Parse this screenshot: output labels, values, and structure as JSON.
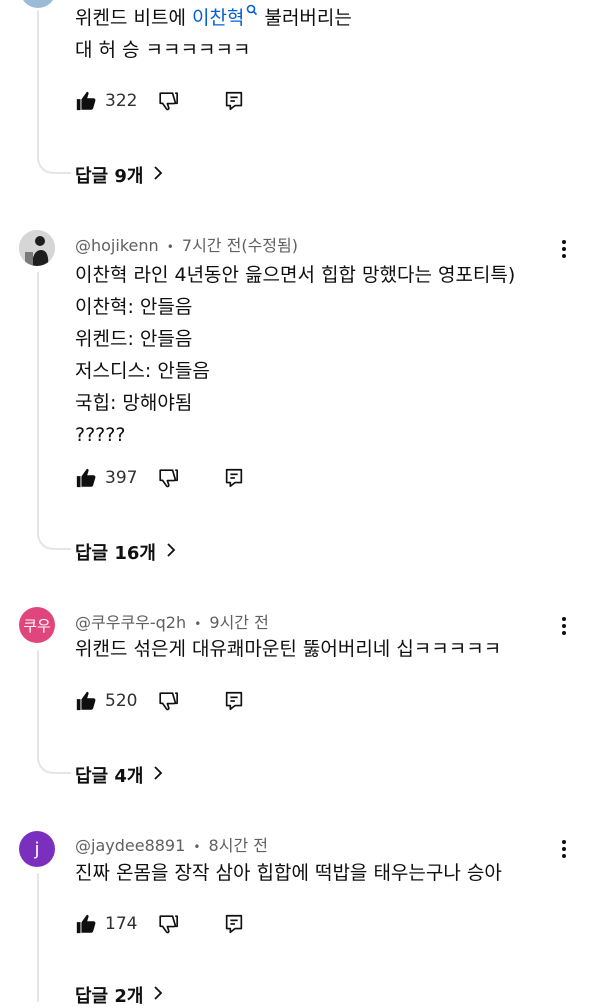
{
  "comments": [
    {
      "lines": [
        {
          "before": "위켄드 비트에 ",
          "mention": "이찬혁",
          "after": " 불러버리는"
        },
        {
          "text": "대 허 승 ㅋㅋㅋㅋㅋㅋ"
        }
      ],
      "likes": "322",
      "replies_label": "답글 9개"
    },
    {
      "handle": "@hojikenn",
      "dot": "•",
      "time": "7시간 전(수정됨)",
      "lines": [
        "이찬혁 라인 4년동안 읊으면서 힙합 망했다는 영포티특)",
        "이찬혁: 안들음",
        "위켄드: 안들음",
        "저스디스: 안들음",
        "국힙: 망해야됨",
        "?????"
      ],
      "likes": "397",
      "replies_label": "답글 16개"
    },
    {
      "avatar_text": "쿠우",
      "avatar_color": "#e0457b",
      "handle": "@쿠우쿠우-q2h",
      "dot": "•",
      "time": "9시간 전",
      "lines": [
        "위캔드 섞은게 대유쾌마운틴 뚫어버리네 십ㅋㅋㅋㅋㅋ"
      ],
      "likes": "520",
      "replies_label": "답글 4개"
    },
    {
      "avatar_text": "j",
      "avatar_color": "#7b2fbe",
      "handle": "@jaydee8891",
      "dot": "•",
      "time": "8시간 전",
      "lines": [
        "진짜 온몸을 장작 삼아 힙합에 떡밥을 태우는구나 승아"
      ],
      "likes": "174",
      "replies_label": "답글 2개"
    }
  ],
  "icons": {
    "like": "thumbs-up-icon",
    "dislike": "thumbs-down-icon",
    "reply": "reply-icon",
    "more": "more-vertical-icon",
    "chevron": "chevron-right-icon",
    "search": "search-icon"
  },
  "colors": {
    "mention": "#065fd4",
    "meta": "#606060",
    "thread": "#e5e5e5"
  }
}
